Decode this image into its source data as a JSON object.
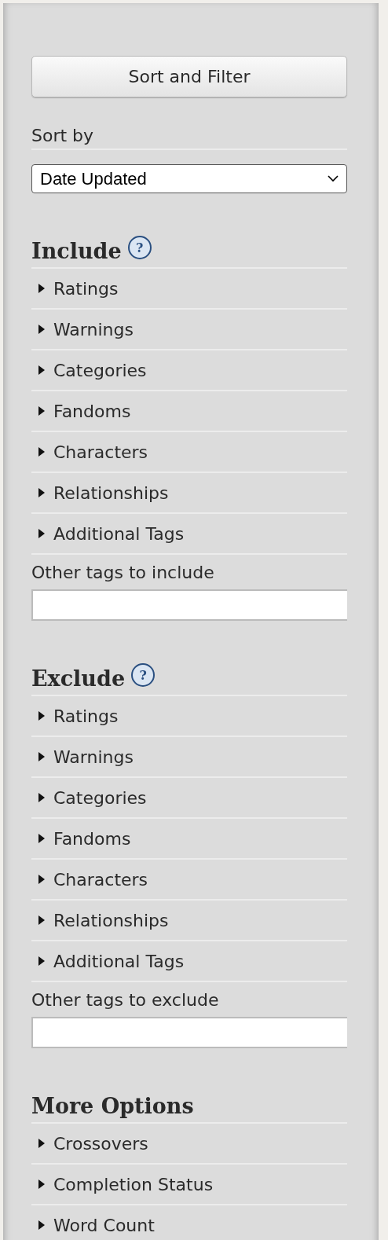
{
  "button": {
    "label": "Sort and Filter"
  },
  "sort_by": {
    "label": "Sort by",
    "value": "Date Updated"
  },
  "sections": [
    {
      "heading": "Include",
      "help_icon": "?",
      "items": [
        {
          "label": "Ratings",
          "expanded": false
        },
        {
          "label": "Warnings",
          "expanded": false
        },
        {
          "label": "Categories",
          "expanded": false
        },
        {
          "label": "Fandoms",
          "expanded": false
        },
        {
          "label": "Characters",
          "expanded": false
        },
        {
          "label": "Relationships",
          "expanded": false
        },
        {
          "label": "Additional Tags",
          "expanded": false
        }
      ],
      "other_tags": {
        "label": "Other tags to include"
      }
    },
    {
      "heading": "Exclude",
      "help_icon": "?",
      "items": [
        {
          "label": "Ratings",
          "expanded": false
        },
        {
          "label": "Warnings",
          "expanded": false
        },
        {
          "label": "Categories",
          "expanded": false
        },
        {
          "label": "Fandoms",
          "expanded": false
        },
        {
          "label": "Characters",
          "expanded": false
        },
        {
          "label": "Relationships",
          "expanded": false
        },
        {
          "label": "Additional Tags",
          "expanded": false
        }
      ],
      "other_tags": {
        "label": "Other tags to exclude"
      }
    },
    {
      "heading": "More Options",
      "items": [
        {
          "label": "Crossovers",
          "expanded": false
        },
        {
          "label": "Completion Status",
          "expanded": false
        },
        {
          "label": "Word Count",
          "expanded": false
        }
      ]
    }
  ]
}
